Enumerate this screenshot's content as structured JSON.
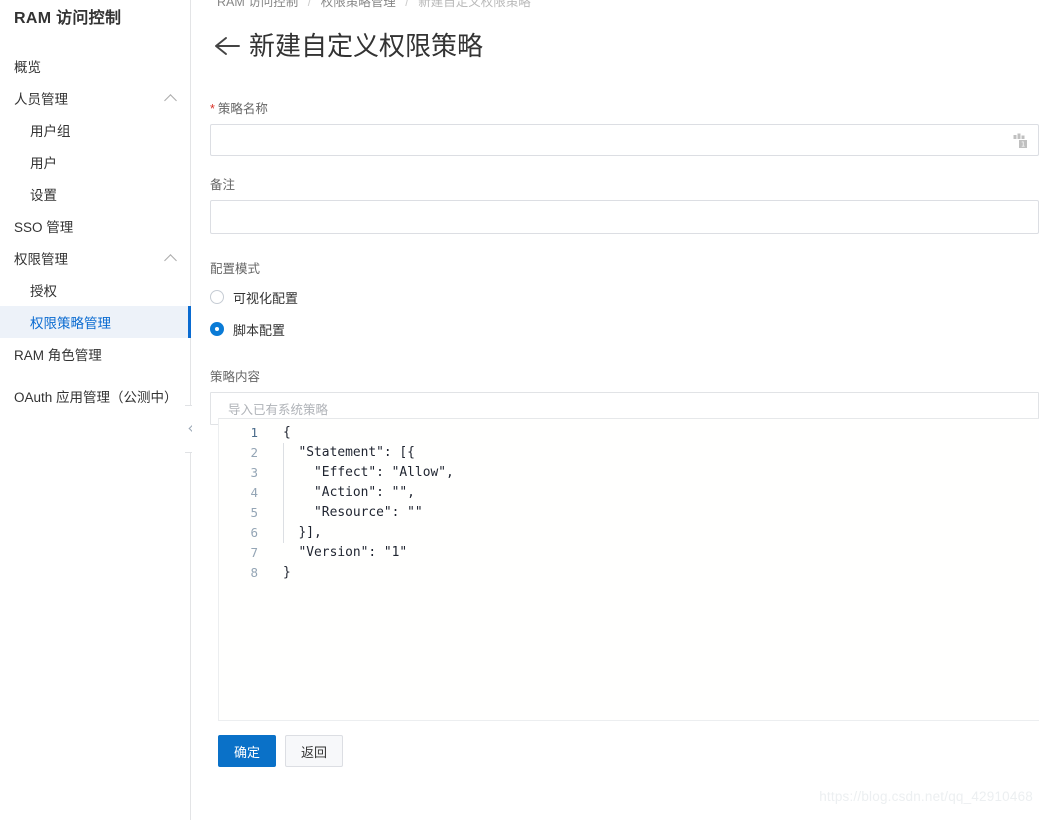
{
  "sidebar": {
    "title": "RAM 访问控制",
    "items": [
      {
        "label": "概览",
        "level": 1,
        "selected": false,
        "expandable": false
      },
      {
        "label": "人员管理",
        "level": 1,
        "selected": false,
        "expandable": true
      },
      {
        "label": "用户组",
        "level": 2,
        "selected": false,
        "expandable": false
      },
      {
        "label": "用户",
        "level": 2,
        "selected": false,
        "expandable": false
      },
      {
        "label": "设置",
        "level": 2,
        "selected": false,
        "expandable": false
      },
      {
        "label": "SSO 管理",
        "level": 1,
        "selected": false,
        "expandable": false
      },
      {
        "label": "权限管理",
        "level": 1,
        "selected": false,
        "expandable": true
      },
      {
        "label": "授权",
        "level": 2,
        "selected": false,
        "expandable": false
      },
      {
        "label": "权限策略管理",
        "level": 2,
        "selected": true,
        "expandable": false
      },
      {
        "label": "RAM 角色管理",
        "level": 1,
        "selected": false,
        "expandable": false
      },
      {
        "label": "OAuth 应用管理（公测中）",
        "level": 1,
        "selected": false,
        "expandable": false
      }
    ],
    "collapse_handle_icon": "chevron-left-icon"
  },
  "breadcrumb": {
    "items": [
      "RAM 访问控制",
      "权限策略管理",
      "新建自定义权限策略"
    ],
    "separator": "/"
  },
  "page": {
    "back_icon": "arrow-left-icon",
    "title": "新建自定义权限策略"
  },
  "form": {
    "policy_name": {
      "label": "策略名称",
      "required_mark": "*",
      "value": "",
      "placeholder": "",
      "suffix_icon": "counter-icon"
    },
    "remark": {
      "label": "备注",
      "value": "",
      "placeholder": ""
    },
    "config_mode": {
      "label": "配置模式",
      "options": [
        {
          "label": "可视化配置",
          "checked": false
        },
        {
          "label": "脚本配置",
          "checked": true
        }
      ]
    },
    "policy_content": {
      "label": "策略内容",
      "import_label": "导入已有系统策略"
    }
  },
  "editor": {
    "lines": [
      {
        "n": "1",
        "text": "{"
      },
      {
        "n": "2",
        "text": "  \"Statement\": [{"
      },
      {
        "n": "3",
        "text": "    \"Effect\": \"Allow\","
      },
      {
        "n": "4",
        "text": "    \"Action\": \"\","
      },
      {
        "n": "5",
        "text": "    \"Resource\": \"\""
      },
      {
        "n": "6",
        "text": "  }],"
      },
      {
        "n": "7",
        "text": "  \"Version\": \"1\""
      },
      {
        "n": "8",
        "text": "}"
      }
    ]
  },
  "footer": {
    "confirm_label": "确定",
    "back_label": "返回"
  },
  "watermark": "https://blog.csdn.net/qq_42910468",
  "colors": {
    "accent": "#0a71c8",
    "selected_bg": "#edf2f9",
    "selected_text": "#0a6bd1",
    "required_star": "#d93026",
    "border": "#dcdee3",
    "code_text": "#1f2430",
    "line_number": "#94a5b5"
  }
}
